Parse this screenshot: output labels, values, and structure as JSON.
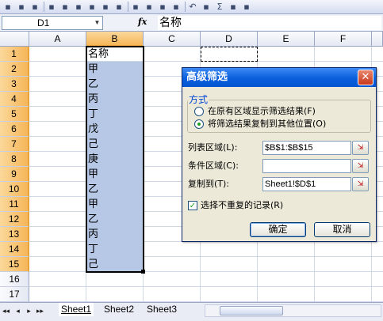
{
  "toolbar": {
    "icons": [
      "new-icon",
      "open-icon",
      "save-icon",
      "permission-icon",
      "email-icon",
      "print-icon",
      "preview-icon",
      "spelling-icon",
      "research-icon",
      "cut-icon",
      "copy-icon",
      "paste-icon",
      "format-painter-icon",
      "undo-icon",
      "hyperlink-icon",
      "autosum-icon",
      "sort-ascending-icon",
      "sort-descending-icon"
    ],
    "glyphs": {
      "undo": "↶",
      "autosum": "Σ",
      "dropdown": "▾"
    }
  },
  "formula_bar": {
    "name_box": "D1",
    "fx_label": "fx",
    "content": "名称"
  },
  "columns": [
    "A",
    "B",
    "C",
    "D",
    "E",
    "F"
  ],
  "rows": [
    "1",
    "2",
    "3",
    "4",
    "5",
    "6",
    "7",
    "8",
    "9",
    "10",
    "11",
    "12",
    "13",
    "14",
    "15",
    "16",
    "17"
  ],
  "column_b_values": [
    "名称",
    "甲",
    "乙",
    "丙",
    "丁",
    "戊",
    "己",
    "庚",
    "甲",
    "乙",
    "甲",
    "乙",
    "丙",
    "丁",
    "己"
  ],
  "sheet_tabs": {
    "nav": [
      "◂◂",
      "◂",
      "▸",
      "▸▸"
    ],
    "tabs": [
      "Sheet1",
      "Sheet2",
      "Sheet3"
    ],
    "active": "Sheet1"
  },
  "dialog": {
    "title": "高级筛选",
    "close_glyph": "✕",
    "method_group": "方式",
    "radio_in_place": "在原有区域显示筛选结果(F)",
    "radio_copy": "将筛选结果复制到其他位置(O)",
    "list_range_label": "列表区域(L):",
    "list_range_value": "$B$1:$B$15",
    "criteria_range_label": "条件区域(C):",
    "criteria_range_value": "",
    "copy_to_label": "复制到(T):",
    "copy_to_value": "Sheet1!$D$1",
    "unique_records_label": "选择不重复的记录(R)",
    "unique_records_checked": true,
    "ok_label": "确定",
    "cancel_label": "取消",
    "range_button_glyph": "⇲"
  }
}
